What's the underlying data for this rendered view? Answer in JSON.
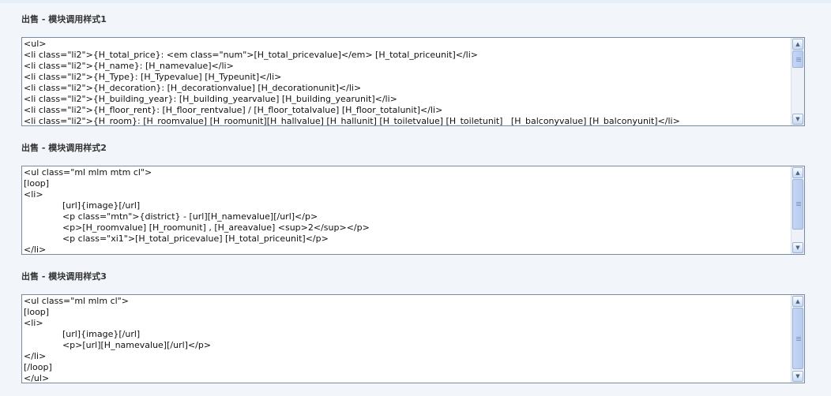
{
  "panels": [
    {
      "title": "出售 - 模块调用样式1",
      "code": "<ul>\n<li class=\"li2\">{H_total_price}: <em class=\"num\">[H_total_pricevalue]</em> [H_total_priceunit]</li>\n<li class=\"li2\">{H_name}: [H_namevalue]</li>\n<li class=\"li2\">{H_Type}: [H_Typevalue] [H_Typeunit]</li>\n<li class=\"li2\">{H_decoration}: [H_decorationvalue] [H_decorationunit]</li>\n<li class=\"li2\">{H_building_year}: [H_building_yearvalue] [H_building_yearunit]</li>\n<li class=\"li2\">{H_floor_rent}: [H_floor_rentvalue] / [H_floor_totalvalue] [H_floor_totalunit]</li>\n<li class=\"li2\">{H_room}: [H_roomvalue] [H_roomunit][H_hallvalue] [H_hallunit] [H_toiletvalue] [H_toiletunit]   [H_balconyvalue] [H_balconyunit]</li>"
    },
    {
      "title": "出售 - 模块调用样式2",
      "code": "<ul class=\"ml mlm mtm cl\">\n[loop]\n<li>\n              [url]{image}[/url]\n              <p class=\"mtn\">{district} - [url][H_namevalue][/url]</p>\n              <p>[H_roomvalue] [H_roomunit] , [H_areavalue] <sup>2</sup></p>\n              <p class=\"xi1\">[H_total_pricevalue] [H_total_priceunit]</p>\n</li>"
    },
    {
      "title": "出售 - 模块调用样式3",
      "code": "<ul class=\"ml mlm cl\">\n[loop]\n<li>\n              [url]{image}[/url]\n              <p>[url][H_namevalue][/url]</p>\n</li>\n[/loop]\n</ul>"
    }
  ],
  "icons": {
    "up": "▲",
    "down": "▼"
  }
}
